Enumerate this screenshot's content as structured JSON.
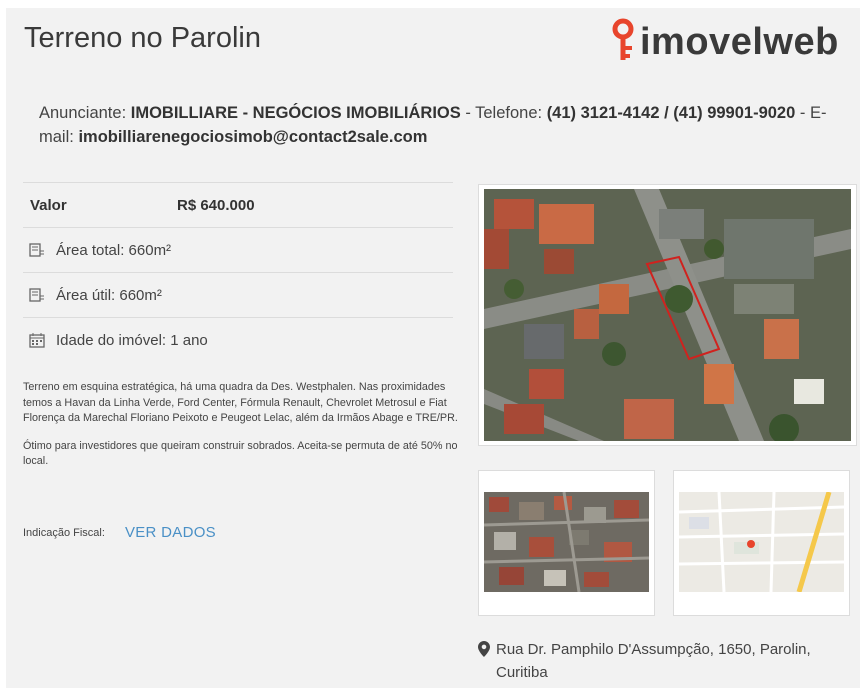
{
  "title": "Terreno no Parolin",
  "logo": {
    "text": "imovelweb",
    "accent": "#e8452c"
  },
  "advertiser": {
    "label": "Anunciante:",
    "name": "IMOBILLIARE - NEGÓCIOS IMOBILIÁRIOS",
    "phone_label": "- Telefone:",
    "phone": "(41) 3121-4142 / (41) 99901-9020",
    "email_label": "- E-mail:",
    "email": "imobilliarenegociosimob@contact2sale.com"
  },
  "specs": {
    "price_label": "Valor",
    "price_value": "R$ 640.000",
    "area_total": "Área total: 660m²",
    "area_util": "Área útil: 660m²",
    "idade": "Idade do imóvel: 1 ano",
    "icons": [
      "area-icon",
      "area-icon",
      "calendar-icon"
    ]
  },
  "description": [
    "Terreno em esquina estratégica, há uma quadra da Des. Westphalen. Nas proximidades temos a Havan da Linha Verde, Ford Center, Fórmula Renault, Chevrolet Metrosul e Fiat Florença da Marechal Floriano Peixoto e Peugeot Lelac, além da Irmãos Abage e TRE/PR.",
    "Ótimo para investidores que queiram construir sobrados. Aceita-se permuta de até 50% no local."
  ],
  "fiscal": {
    "label": "Indicação Fiscal:",
    "link": "VER DADOS",
    "link_color": "#4a90c6"
  },
  "address": "Rua Dr. Pamphilo D'Assumpção, 1650, Parolin, Curitiba"
}
